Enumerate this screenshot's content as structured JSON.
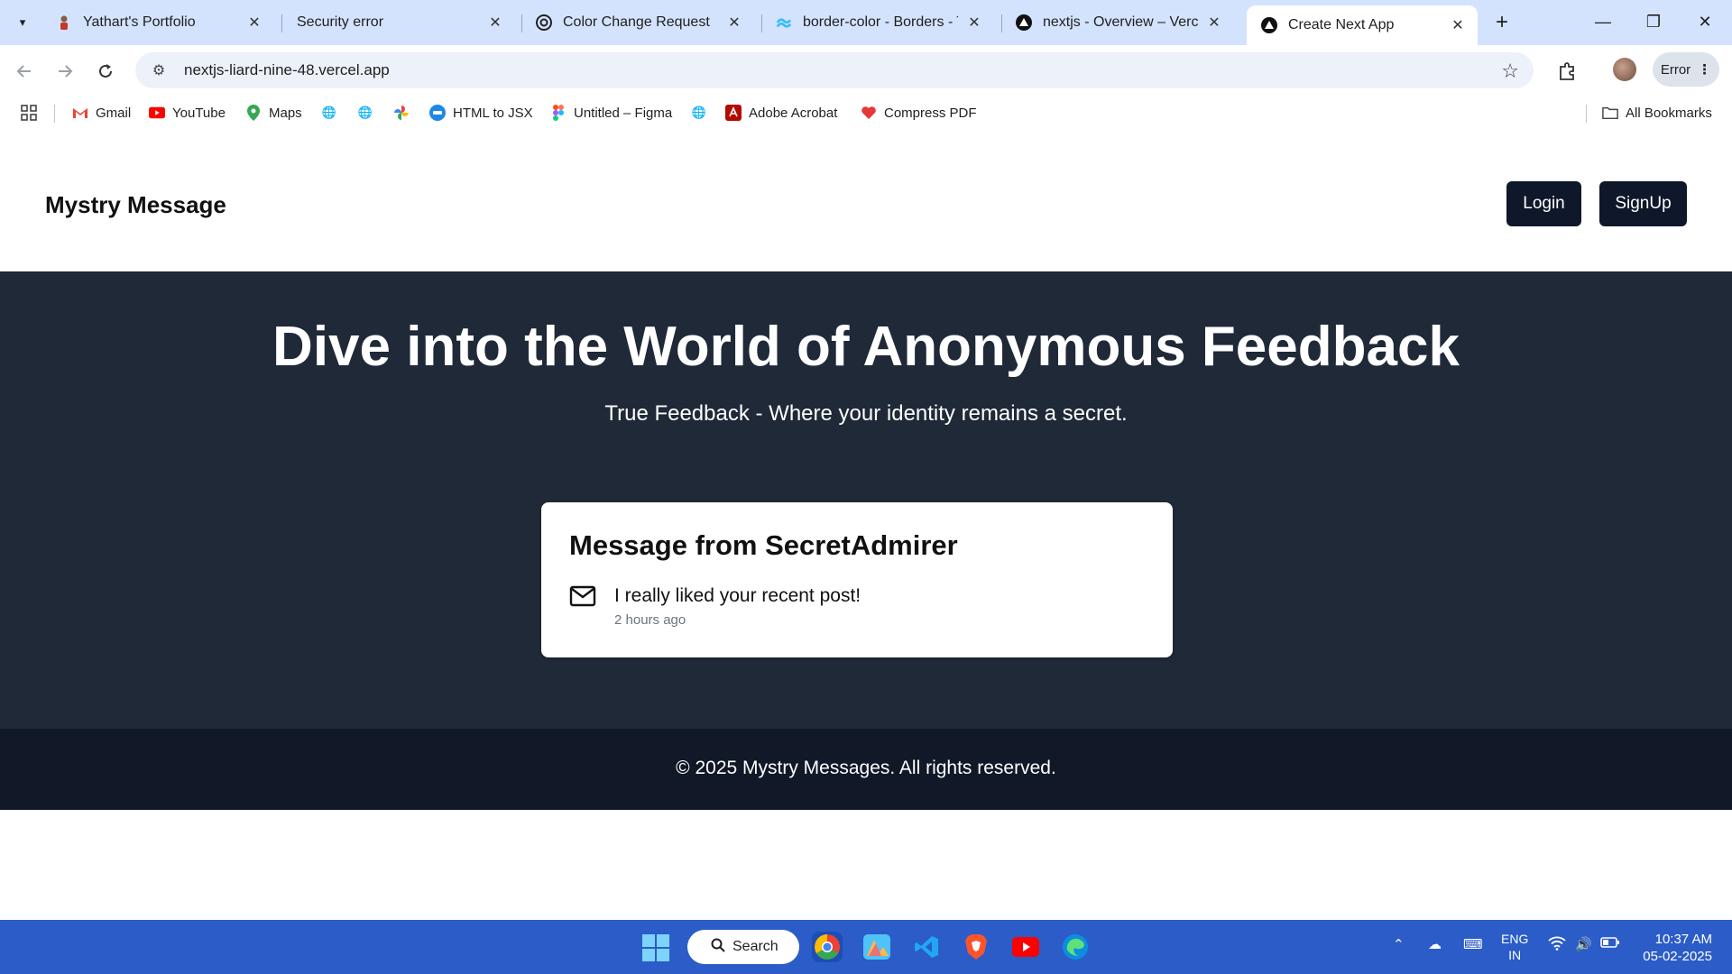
{
  "browser": {
    "tabs": [
      {
        "title": "Yathart's Portfolio",
        "icon": "person-favicon"
      },
      {
        "title": "Security error",
        "icon": "none"
      },
      {
        "title": "Color Change Request",
        "icon": "openai-favicon"
      },
      {
        "title": "border-color - Borders - Ta",
        "icon": "tailwind-favicon"
      },
      {
        "title": "nextjs - Overview – Vercel",
        "icon": "vercel-favicon"
      },
      {
        "title": "Create Next App",
        "icon": "vercel-favicon",
        "active": true
      }
    ],
    "url": "nextjs-liard-nine-48.vercel.app",
    "profile_status": "Error",
    "bookmarks": [
      {
        "label": "Gmail",
        "icon": "gmail-icon"
      },
      {
        "label": "YouTube",
        "icon": "youtube-icon"
      },
      {
        "label": "Maps",
        "icon": "maps-icon"
      },
      {
        "label": "",
        "icon": "globe-icon"
      },
      {
        "label": "",
        "icon": "globe-icon"
      },
      {
        "label": "",
        "icon": "pinwheel-icon"
      },
      {
        "label": "HTML to JSX",
        "icon": "html-jsx-icon"
      },
      {
        "label": "Untitled – Figma",
        "icon": "figma-icon"
      },
      {
        "label": "",
        "icon": "globe-icon"
      },
      {
        "label": "Adobe Acrobat",
        "icon": "acrobat-icon"
      },
      {
        "label": "Compress PDF",
        "icon": "heart-icon"
      }
    ],
    "all_bookmarks": "All Bookmarks"
  },
  "page": {
    "brand": "Mystry Message",
    "login_label": "Login",
    "signup_label": "SignUp",
    "hero_title": "Dive into the World of Anonymous Feedback",
    "hero_subtitle": "True Feedback - Where your identity remains a secret.",
    "card": {
      "title": "Message from SecretAdmirer",
      "message": "I really liked your recent post!",
      "time": "2 hours ago"
    },
    "footer": "© 2025 Mystry Messages. All rights reserved."
  },
  "taskbar": {
    "search_label": "Search",
    "lang_line1": "ENG",
    "lang_line2": "IN",
    "time": "10:37 AM",
    "date": "05-02-2025"
  },
  "colors": {
    "hero_bg": "#1f2937",
    "footer_bg": "#111827",
    "button_bg": "#0f172a",
    "taskbar_bg": "#2b5cc8"
  }
}
